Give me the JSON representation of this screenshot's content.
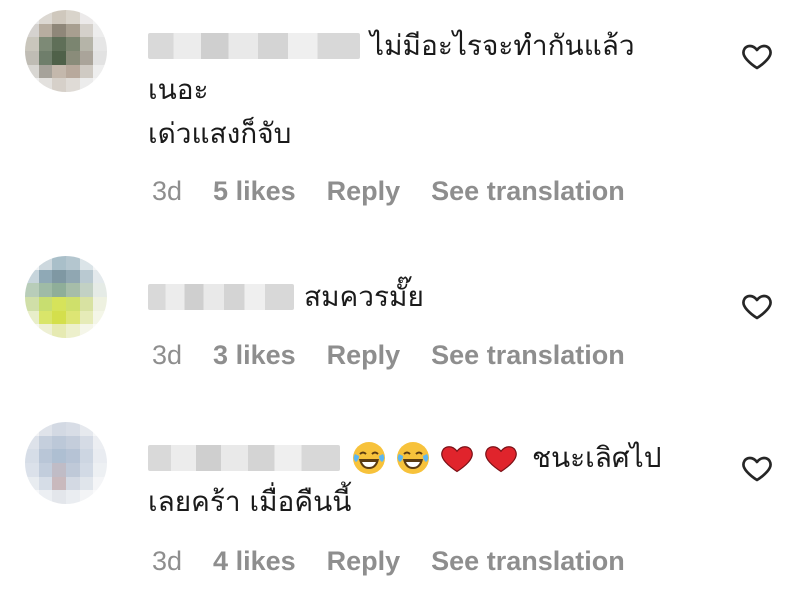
{
  "comments": [
    {
      "text_lines": [
        "ไม่มีอะไรจะทำกันแล้ว",
        "เนอะ",
        "เด่วแสงก็จับ"
      ],
      "time": "3d",
      "likes": "5 likes",
      "reply": "Reply",
      "translate": "See translation",
      "icon": "heart-outline-icon"
    },
    {
      "text_lines": [
        "สมควรมั๊ย"
      ],
      "time": "3d",
      "likes": "3 likes",
      "reply": "Reply",
      "translate": "See translation",
      "icon": "heart-outline-icon"
    },
    {
      "text_lines": [
        "ชนะเลิศไป",
        "เลยคร้า เมื่อคืนนี้"
      ],
      "emojis": [
        "face-with-tears-of-joy-icon",
        "face-with-tears-of-joy-icon",
        "red-heart-icon",
        "red-heart-icon"
      ],
      "time": "3d",
      "likes": "4 likes",
      "reply": "Reply",
      "translate": "See translation",
      "icon": "heart-outline-icon"
    }
  ],
  "colors": {
    "meta": "#8e8e8e",
    "text": "#1a1a1a",
    "heart_red": "#e0242c",
    "emoji_yellow": "#f7c23b"
  }
}
